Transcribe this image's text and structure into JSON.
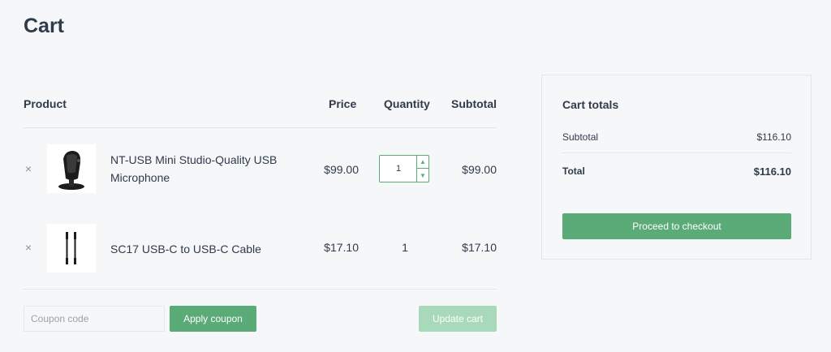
{
  "page": {
    "title": "Cart"
  },
  "table": {
    "headers": {
      "product": "Product",
      "price": "Price",
      "quantity": "Quantity",
      "subtotal": "Subtotal"
    },
    "items": [
      {
        "remove_icon": "×",
        "name": "NT-USB Mini Studio-Quality USB Microphone",
        "price": "$99.00",
        "quantity": "1",
        "subtotal": "$99.00",
        "image_icon": "microphone-icon"
      },
      {
        "remove_icon": "×",
        "name": "SC17 USB-C to USB-C Cable",
        "price": "$17.10",
        "quantity": "1",
        "subtotal": "$17.10",
        "image_icon": "cable-icon"
      }
    ]
  },
  "actions": {
    "coupon_placeholder": "Coupon code",
    "apply_label": "Apply coupon",
    "update_label": "Update cart"
  },
  "totals": {
    "title": "Cart totals",
    "subtotal_label": "Subtotal",
    "subtotal_value": "$116.10",
    "total_label": "Total",
    "total_value": "$116.10",
    "checkout_label": "Proceed to checkout"
  },
  "colors": {
    "accent": "#5aab78",
    "accent_disabled": "#a9d9bb",
    "text": "#2f3a4a",
    "background": "#f6f7f9"
  }
}
